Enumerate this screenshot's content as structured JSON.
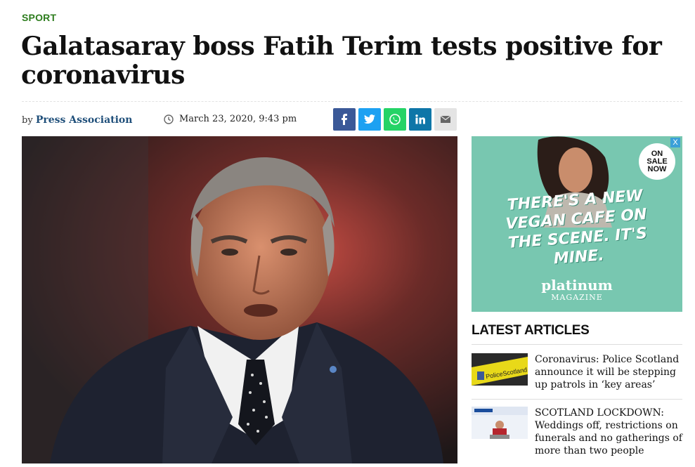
{
  "section": {
    "label": "SPORT"
  },
  "article": {
    "headline": "Galatasaray boss Fatih Terim tests positive for coronavirus",
    "byline_prefix": "by",
    "author": "Press Association",
    "date": "March 23, 2020, 9:43 pm"
  },
  "share": [
    "facebook-icon",
    "twitter-icon",
    "whatsapp-icon",
    "linkedin-icon",
    "email-icon"
  ],
  "ad": {
    "close": "X",
    "badge": [
      "ON",
      "SALE",
      "NOW"
    ],
    "tagline": "THERE'S A NEW VEGAN CAFE ON THE SCENE. IT'S MINE.",
    "brand": "platinum",
    "brand_sub": "MAGAZINE"
  },
  "sidebar": {
    "title": "LATEST ARTICLES",
    "articles": [
      {
        "title": "Coronavirus: Police Scotland announce it will be stepping up patrols in ‘key areas’",
        "thumb_label": "PoliceScotland"
      },
      {
        "title": "SCOTLAND LOCKDOWN: Weddings off, restrictions on funerals and no gatherings of more than two people"
      }
    ]
  },
  "colors": {
    "section": "#2e7d1e",
    "author": "#1f4f7a",
    "ad_bg": "#78c7b0"
  }
}
